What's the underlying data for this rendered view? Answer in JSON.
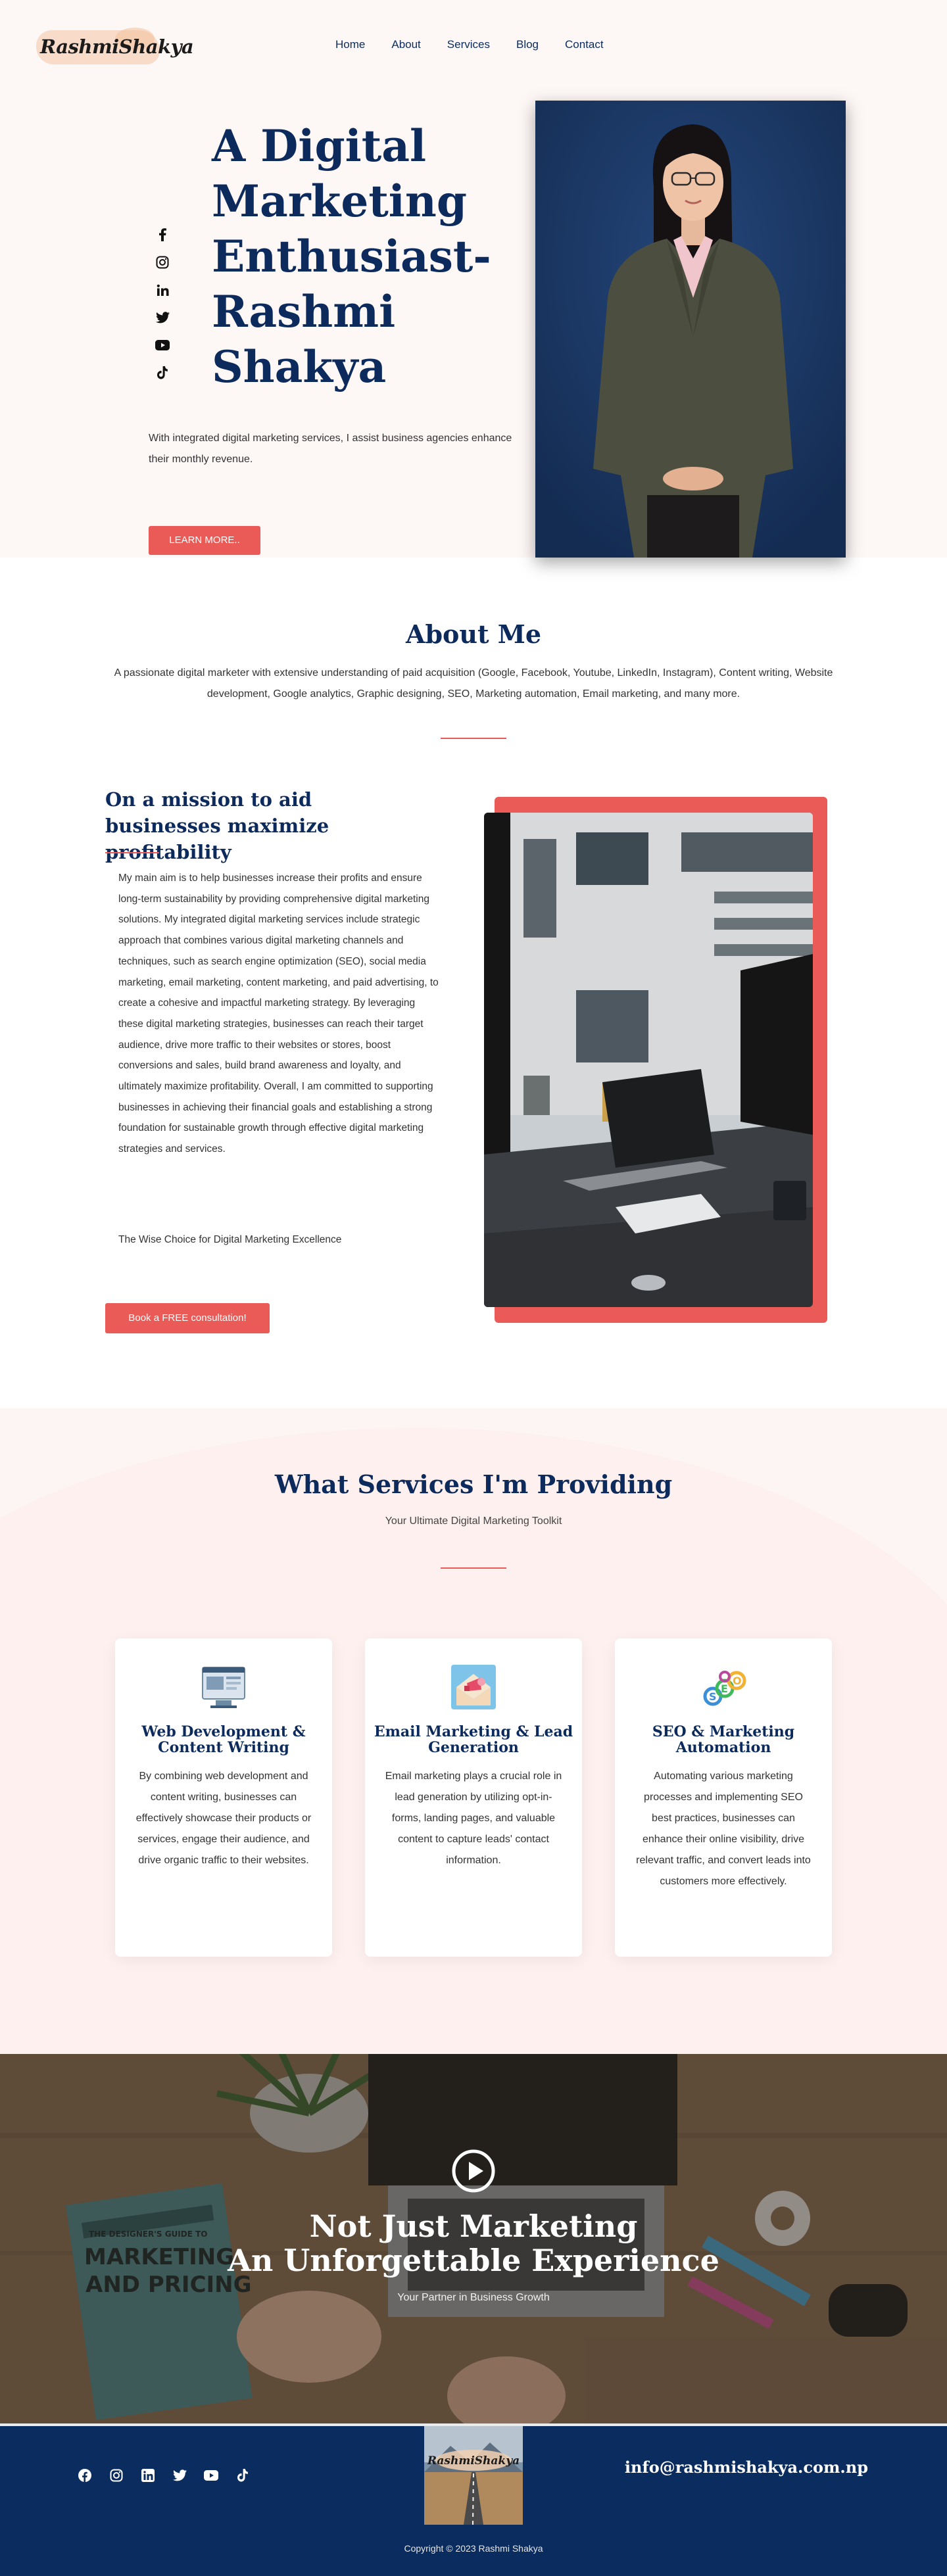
{
  "brand": {
    "logo_text": "RashmiShakya"
  },
  "nav": [
    "Home",
    "About",
    "Services",
    "Blog",
    "Contact"
  ],
  "hero": {
    "title": "A Digital Marketing Enthusiast- Rashmi Shakya",
    "subtitle": "With integrated digital marketing services, I assist business agencies enhance their monthly revenue.",
    "button": "LEARN MORE..",
    "social_icons": [
      "facebook-icon",
      "instagram-icon",
      "linkedin-icon",
      "twitter-icon",
      "youtube-icon",
      "tiktok-icon"
    ]
  },
  "about": {
    "heading": "About Me",
    "text": "A passionate digital marketer with extensive understanding of paid acquisition (Google, Facebook, Youtube, LinkedIn, Instagram), Content writing, Website development, Google analytics,  Graphic designing, SEO, Marketing automation, Email marketing, and many more."
  },
  "mission": {
    "heading": "On a mission to aid businesses maximize profitability",
    "text": "My main aim is to help businesses increase their profits and ensure long-term sustainability by providing comprehensive digital marketing solutions. My integrated digital marketing services include strategic approach that combines various digital marketing channels and techniques, such as search engine optimization (SEO), social media marketing, email marketing, content marketing, and paid advertising, to create a cohesive and impactful marketing strategy. By leveraging these digital marketing strategies, businesses can reach their target audience, drive more traffic to their websites or stores, boost conversions and sales, build brand awareness and loyalty, and ultimately maximize profitability. Overall, I am committed to supporting businesses in achieving their financial goals and establishing a strong foundation for sustainable growth through effective digital marketing strategies and services.",
    "tagline": "The Wise Choice for Digital Marketing Excellence",
    "button": "Book a FREE consultation!"
  },
  "services": {
    "heading": "What Services I'm Providing",
    "subtitle": "Your Ultimate Digital Marketing Toolkit",
    "cards": [
      {
        "icon": "web-development-icon",
        "title": "Web Development & Content Writing",
        "text": "By combining web development and content writing, businesses can effectively showcase their products or services, engage their audience, and drive organic traffic to their websites."
      },
      {
        "icon": "email-marketing-icon",
        "title": "Email Marketing & Lead Generation",
        "text": "Email marketing plays a crucial role in lead generation by utilizing opt-in-forms, landing pages, and valuable content to capture leads' contact information."
      },
      {
        "icon": "seo-icon",
        "title": "SEO & Marketing Automation",
        "text": "Automating various marketing processes and implementing SEO best practices, businesses can enhance their online visibility, drive relevant traffic, and convert leads into customers more effectively."
      }
    ]
  },
  "banner": {
    "heading_line1": "Not Just Marketing",
    "heading_line2": "An Unforgettable Experience",
    "subtitle": "Your Partner in Business Growth",
    "book_line1": "THE DESIGNER'S GUIDE TO",
    "book_line2": "MARKETING",
    "book_line3": "AND PRICING"
  },
  "footer": {
    "social_icons": [
      "facebook-icon",
      "instagram-icon",
      "linkedin-icon",
      "twitter-icon",
      "youtube-icon",
      "tiktok-icon"
    ],
    "logo_text": "RashmiShakya",
    "email": "info@rashmishakya.com.np",
    "copyright": "Copyright © 2023 Rashmi Shakya"
  },
  "colors": {
    "navy": "#0c2b5c",
    "accent": "#ea5b57",
    "hero_bg": "#fdf7f6",
    "footer_bg": "#0a2c5e"
  }
}
